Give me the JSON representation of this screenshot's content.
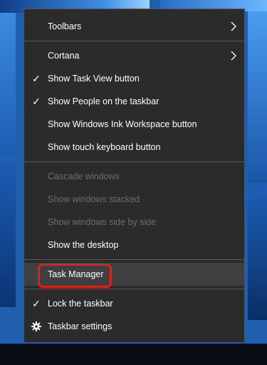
{
  "menu": {
    "items": [
      {
        "label": "Toolbars",
        "submenu": true
      },
      {
        "label": "Cortana",
        "submenu": true
      },
      {
        "label": "Show Task View button",
        "checked": true
      },
      {
        "label": "Show People on the taskbar",
        "checked": true
      },
      {
        "label": "Show Windows Ink Workspace button"
      },
      {
        "label": "Show touch keyboard button"
      },
      {
        "label": "Cascade windows",
        "disabled": true
      },
      {
        "label": "Show windows stacked",
        "disabled": true
      },
      {
        "label": "Show windows side by side",
        "disabled": true
      },
      {
        "label": "Show the desktop"
      },
      {
        "label": "Task Manager",
        "highlighted": true
      },
      {
        "label": "Lock the taskbar",
        "checked": true
      },
      {
        "label": "Taskbar settings",
        "icon": "gear-icon"
      }
    ]
  },
  "colors": {
    "menu_bg": "#2b2b2b",
    "hover_bg": "#3f3f3f",
    "highlight_border": "#e0211b",
    "disabled_text": "#6d6d6d"
  }
}
